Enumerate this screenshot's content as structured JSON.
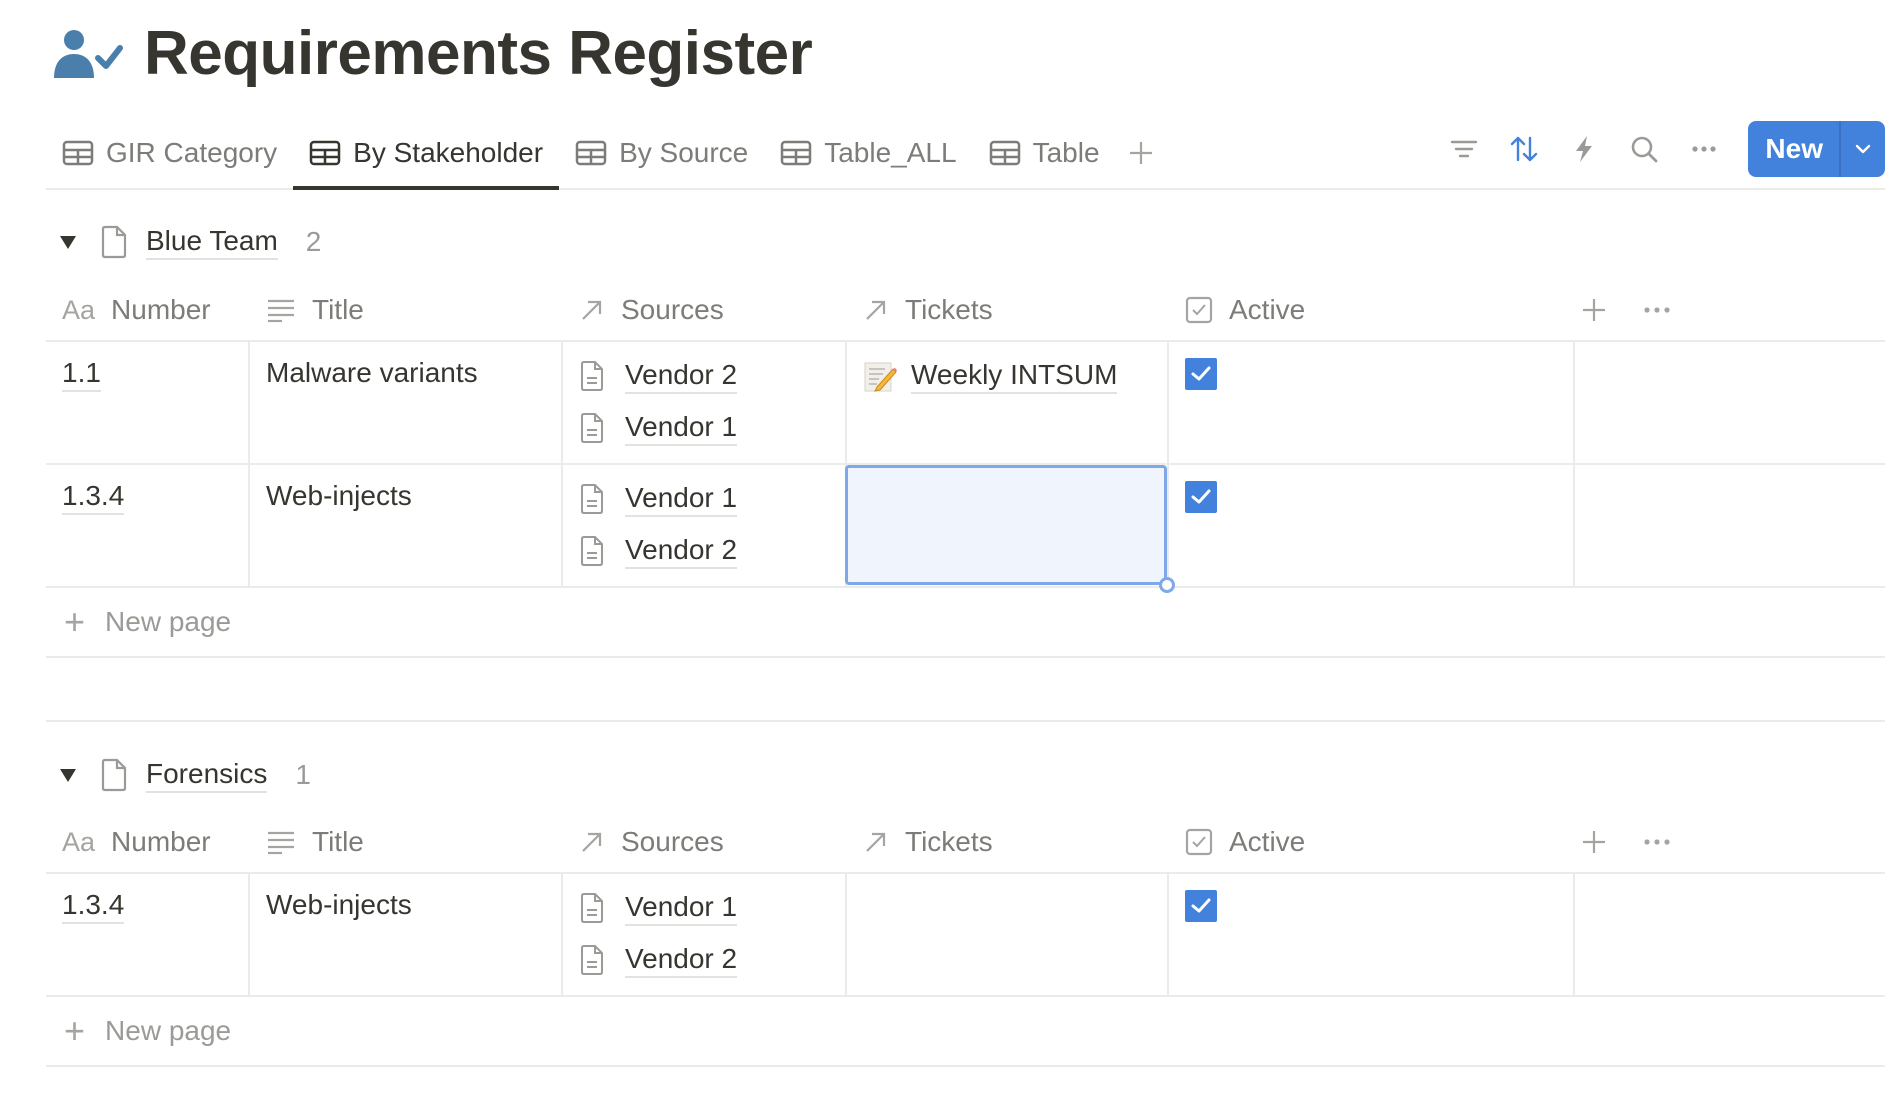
{
  "page": {
    "title": "Requirements Register",
    "icon": "person-check-icon"
  },
  "tabs": [
    {
      "label": "GIR Category",
      "icon": "table-icon",
      "active": false
    },
    {
      "label": "By Stakeholder",
      "icon": "table-icon",
      "active": true
    },
    {
      "label": "By Source",
      "icon": "table-icon",
      "active": false
    },
    {
      "label": "Table_ALL",
      "icon": "table-icon",
      "active": false
    },
    {
      "label": "Table",
      "icon": "table-icon",
      "active": false
    }
  ],
  "toolbar": {
    "add_view": "+",
    "filter": "filter-icon",
    "sort": "sort-icon",
    "automation": "lightning-icon",
    "search": "search-icon",
    "more": "more-icon",
    "new_label": "New",
    "accent": "#4382dc"
  },
  "columns": [
    {
      "label": "Number",
      "icon_text": "Aa",
      "type": "title"
    },
    {
      "label": "Title",
      "icon": "text-lines-icon"
    },
    {
      "label": "Sources",
      "icon": "relation-arrow-icon"
    },
    {
      "label": "Tickets",
      "icon": "relation-arrow-icon"
    },
    {
      "label": "Active",
      "icon": "checkbox-icon"
    }
  ],
  "groups": [
    {
      "name": "Blue Team",
      "count": "2",
      "rows": [
        {
          "number": "1.1",
          "title": "Malware variants",
          "sources": [
            "Vendor 2",
            "Vendor 1"
          ],
          "tickets": [
            "Weekly INTSUM"
          ],
          "active": true
        },
        {
          "number": "1.3.4",
          "title": "Web-injects",
          "sources": [
            "Vendor 1",
            "Vendor 2"
          ],
          "tickets": [],
          "active": true
        }
      ],
      "new_page": "New page"
    },
    {
      "name": "Forensics",
      "count": "1",
      "rows": [
        {
          "number": "1.3.4",
          "title": "Web-injects",
          "sources": [
            "Vendor 1",
            "Vendor 2"
          ],
          "tickets": [],
          "active": true
        }
      ],
      "new_page": "New page"
    }
  ]
}
